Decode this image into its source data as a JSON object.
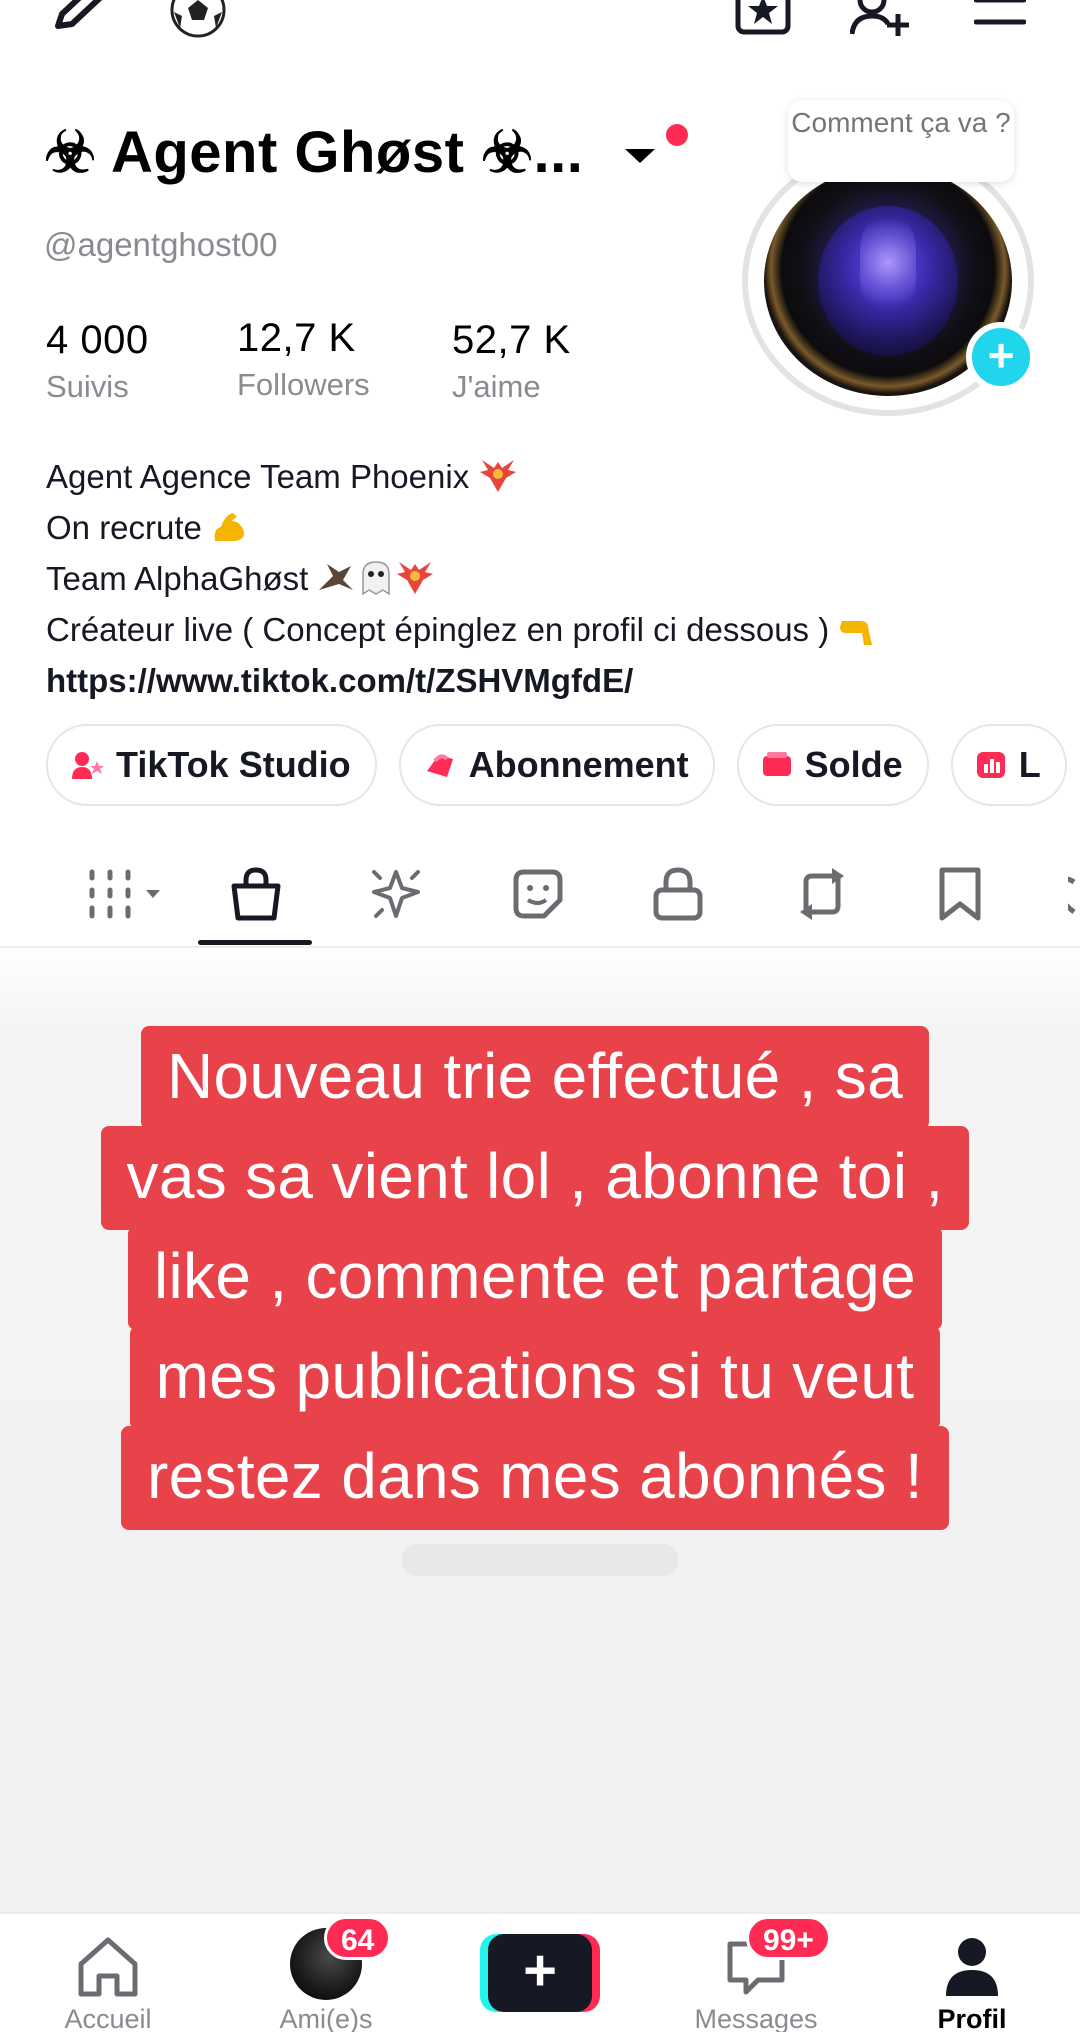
{
  "profile": {
    "display_name": "☣ Agent Ghøst ☣...",
    "username": "@agentghost00",
    "tooltip": "Comment ça va ?",
    "stats": [
      {
        "value": "4 000",
        "label": "Suivis"
      },
      {
        "value": "12,7 K",
        "label": "Followers"
      },
      {
        "value": "52,7 K",
        "label": "J'aime"
      }
    ],
    "bio": [
      "Agent Agence Team Phoenix",
      "On recrute",
      "Team AlphaGhøst",
      "Créateur live ( Concept épinglez en profil ci dessous )"
    ],
    "bio_link": "https://www.tiktok.com/t/ZSHVMgfdE/"
  },
  "chips": [
    {
      "label": "TikTok Studio",
      "icon": "studio-icon"
    },
    {
      "label": "Abonnement",
      "icon": "subscription-icon"
    },
    {
      "label": "Solde",
      "icon": "wallet-icon"
    },
    {
      "label": "L",
      "icon": "chart-icon"
    }
  ],
  "tabs": [
    "grid-icon",
    "shop-bag-icon",
    "sparkle-icon",
    "sticker-icon",
    "lock-icon",
    "repost-icon",
    "bookmark-icon"
  ],
  "overlay_text": [
    "Nouveau trie effectué , sa",
    "vas sa vient lol , abonne toi ,",
    "like , commente et partage",
    "mes publications si tu veut",
    "restez dans mes abonnés !"
  ],
  "bottom_nav": {
    "home": "Accueil",
    "friends": "Ami(e)s",
    "friends_badge": "64",
    "create": "+",
    "messages": "Messages",
    "messages_badge": "99+",
    "profile": "Profil"
  },
  "colors": {
    "accent_red": "#fe2c55",
    "accent_cyan": "#20d5ec",
    "overlay_bg": "#e8424b"
  }
}
